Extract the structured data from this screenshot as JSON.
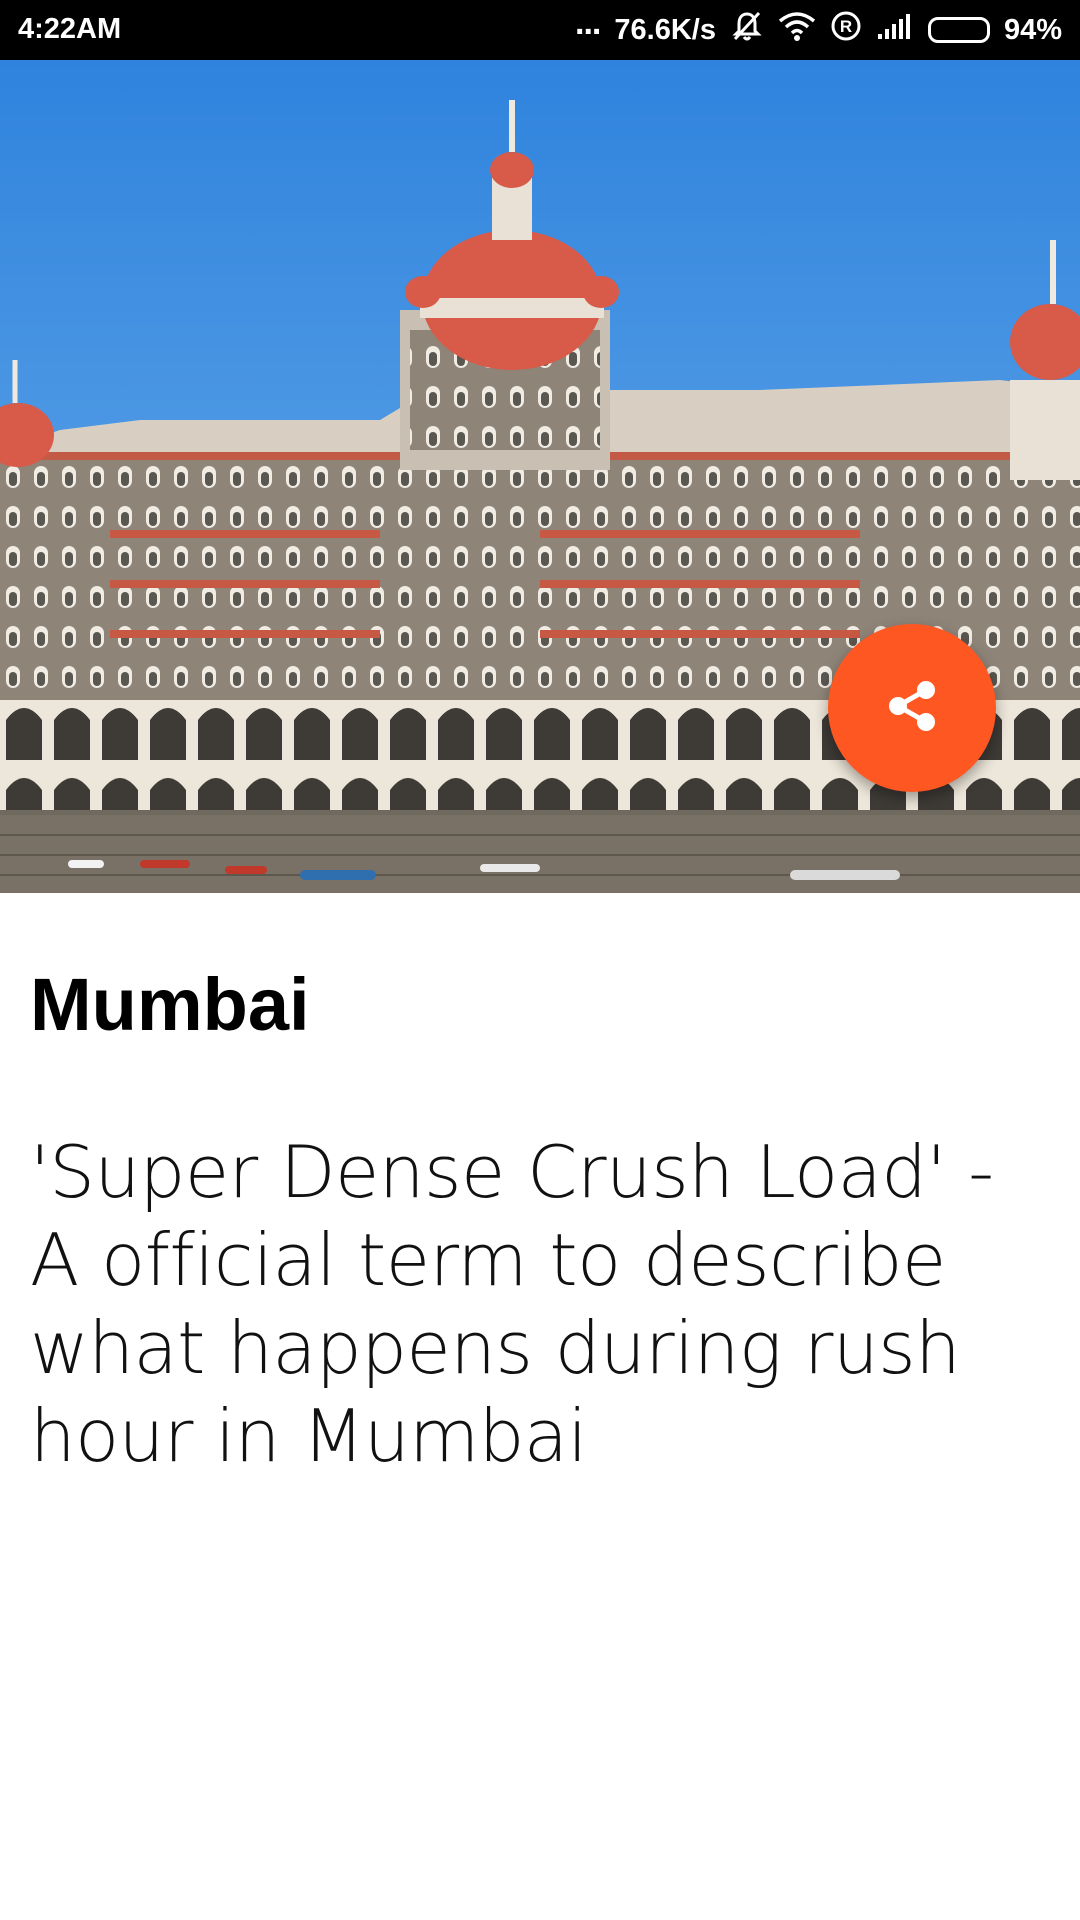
{
  "status_bar": {
    "time": "4:22AM",
    "dots": "...",
    "net_speed": "76.6K/s",
    "battery_percent": "94%",
    "icons": [
      "silent-alarm-icon",
      "wifi-icon",
      "roaming-r-icon",
      "signal-bars-icon",
      "battery-icon"
    ]
  },
  "hero": {
    "image_subject": "taj-mahal-palace-hotel-photo",
    "sky_color": "#3A8DE0",
    "dome_color": "#D85A48",
    "water_color": "#3FA8A0"
  },
  "fab": {
    "icon": "share-icon",
    "color": "#FF5722"
  },
  "content": {
    "title": "Mumbai",
    "description": "'Super Dense Crush Load' - A official term to describe what happens during rush hour in Mumbai"
  }
}
